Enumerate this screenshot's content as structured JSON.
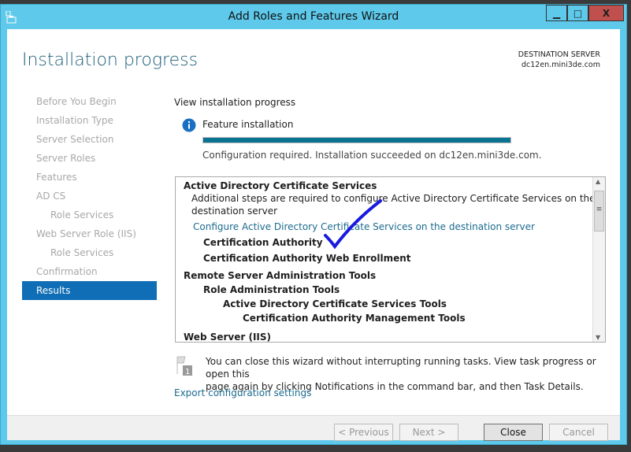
{
  "window": {
    "title": "Add Roles and Features Wizard",
    "minimize": "▁",
    "maximize": "□",
    "close": "X",
    "close_color": "#c0504d",
    "frame_color": "#5ec9ea"
  },
  "header": {
    "page_title": "Installation progress",
    "dest_label": "DESTINATION SERVER",
    "dest_server": "dc12en.mini3de.com"
  },
  "nav": {
    "items": [
      {
        "label": "Before You Begin",
        "sub": false
      },
      {
        "label": "Installation Type",
        "sub": false
      },
      {
        "label": "Server Selection",
        "sub": false
      },
      {
        "label": "Server Roles",
        "sub": false
      },
      {
        "label": "Features",
        "sub": false
      },
      {
        "label": "AD CS",
        "sub": false
      },
      {
        "label": "Role Services",
        "sub": true
      },
      {
        "label": "Web Server Role (IIS)",
        "sub": false
      },
      {
        "label": "Role Services",
        "sub": true
      },
      {
        "label": "Confirmation",
        "sub": false
      },
      {
        "label": "Results",
        "sub": false,
        "active": true
      }
    ]
  },
  "main": {
    "section_title": "View installation progress",
    "feature_label": "Feature installation",
    "progress_percent": 100,
    "progress_color": "#0a7391",
    "status": "Configuration required. Installation succeeded on dc12en.mini3de.com.",
    "results": [
      {
        "text": "Active Directory Certificate Services",
        "bold": true,
        "indent": 0
      },
      {
        "text": "Additional steps are required to configure Active Directory Certificate Services on the",
        "indent": 1
      },
      {
        "text": "destination server",
        "indent": 1
      },
      {
        "text": "Configure Active Directory Certificate Services on the destination server",
        "link": true,
        "indent": 1
      },
      {
        "text": "Certification Authority",
        "bold": true,
        "indent": 2
      },
      {
        "text": "Certification Authority Web Enrollment",
        "bold": true,
        "indent": 2
      },
      {
        "text": "Remote Server Administration Tools",
        "bold": true,
        "indent": 0
      },
      {
        "text": "Role Administration Tools",
        "bold": true,
        "indent": 2
      },
      {
        "text": "Active Directory Certificate Services Tools",
        "bold": true,
        "indent": 4
      },
      {
        "text": "Certification Authority Management Tools",
        "bold": true,
        "indent": 6
      },
      {
        "text": "Web Server (IIS)",
        "bold": true,
        "indent": 0
      }
    ],
    "notice_line1": "You can close this wizard without interrupting running tasks. View task progress or open this",
    "notice_line2": "page again by clicking Notifications in the command bar, and then Task Details.",
    "notice_badge": "1",
    "export_link": "Export configuration settings",
    "annotation_color": "#1a1adf"
  },
  "footer": {
    "previous": "< Previous",
    "next": "Next >",
    "close": "Close",
    "cancel": "Cancel"
  }
}
